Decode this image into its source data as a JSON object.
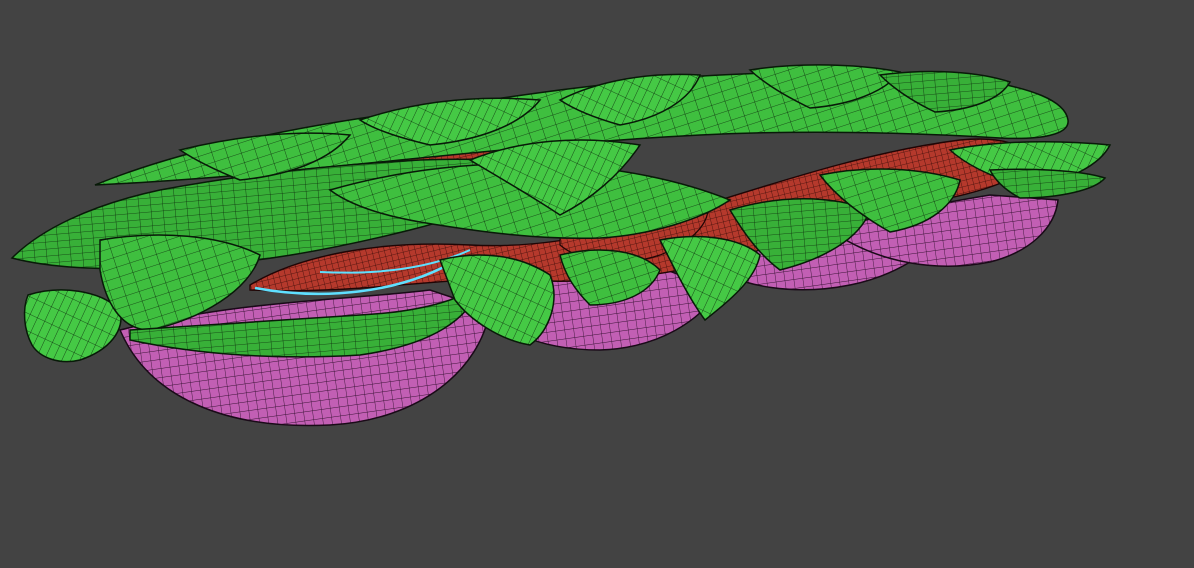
{
  "viewport": {
    "background_color": "#434343"
  },
  "materials": {
    "leaf_fill": "#3fbf3f",
    "leaf_dark": "#2c8f2c",
    "wire_color": "#0a0a0a",
    "meat_fill": "#b5392c",
    "meat_dark": "#8c2319",
    "bread_fill": "#c25fb4",
    "bread_dark": "#8e3d83",
    "selection_color": "#5fe0ff"
  }
}
